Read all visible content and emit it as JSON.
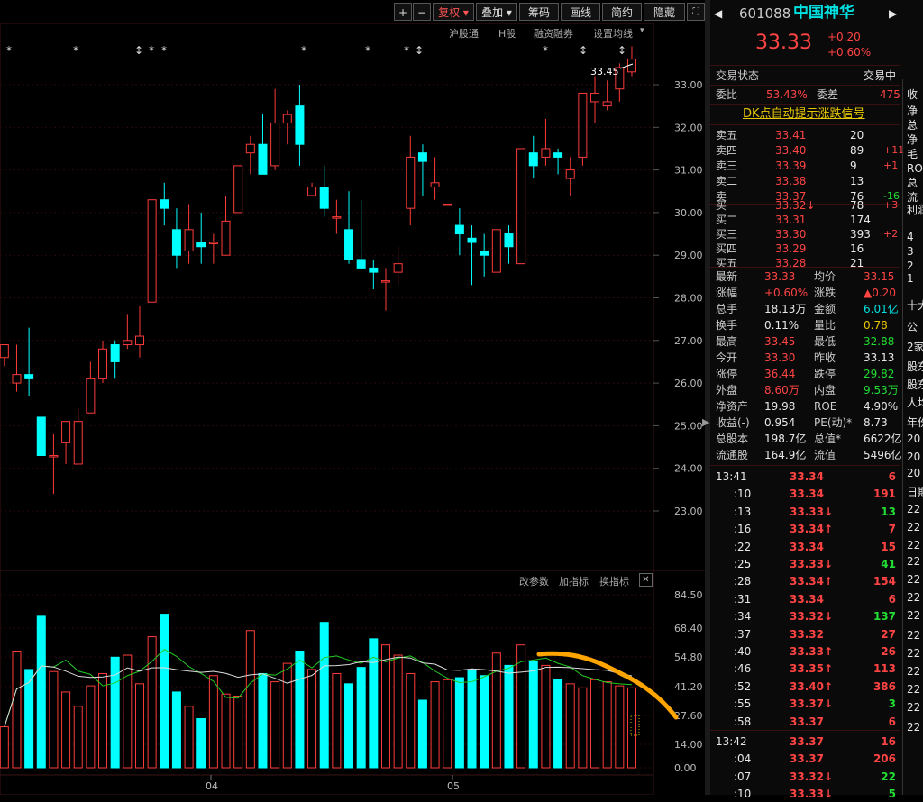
{
  "toolbar": {
    "plus": "+",
    "minus": "−",
    "fuquan": "复权",
    "diejia": "叠加",
    "chouma": "筹码",
    "huaxian": "画线",
    "jianyue": "简约",
    "yincang": "隐藏"
  },
  "subbar": [
    "沪股通",
    "H股",
    "融资融券",
    "设置均线"
  ],
  "volbar": [
    "改参数",
    "加指标",
    "换指标"
  ],
  "chart_data": {
    "type": "candlestick",
    "price_axis": [
      "33.00",
      "32.00",
      "31.00",
      "30.00",
      "29.00",
      "28.00",
      "27.00",
      "26.00",
      "25.00",
      "24.00",
      "23.00"
    ],
    "volume_axis": [
      "84.50",
      "68.40",
      "54.80",
      "41.20",
      "27.60",
      "14.00",
      "0.00"
    ],
    "x_labels": [
      "04",
      "05"
    ],
    "annotation": "33.45",
    "markers": [
      "*",
      "*",
      "↕",
      "*",
      "*",
      "*",
      "*",
      "*",
      "↕",
      "*",
      "↕",
      "↕"
    ],
    "candles": [
      [
        26.6,
        26.9,
        26.7,
        26.4
      ],
      [
        26.0,
        26.2,
        26.9,
        25.8
      ],
      [
        26.2,
        26.1,
        27.3,
        25.7
      ],
      [
        25.2,
        24.3,
        25.2,
        24.3
      ],
      [
        24.3,
        24.3,
        24.8,
        23.4
      ],
      [
        24.6,
        25.1,
        25.1,
        24.1
      ],
      [
        24.1,
        25.1,
        25.4,
        24.1
      ],
      [
        25.3,
        26.1,
        26.5,
        25.3
      ],
      [
        26.1,
        26.8,
        27.0,
        26.0
      ],
      [
        26.9,
        26.5,
        27.0,
        26.1
      ],
      [
        26.9,
        27.0,
        27.6,
        26.8
      ],
      [
        26.9,
        27.1,
        27.8,
        26.6
      ],
      [
        27.9,
        30.3,
        30.3,
        27.9
      ],
      [
        30.3,
        30.1,
        30.7,
        29.7
      ],
      [
        29.6,
        29.0,
        30.1,
        28.7
      ],
      [
        29.1,
        29.6,
        30.2,
        28.8
      ],
      [
        29.3,
        29.2,
        30.0,
        28.8
      ],
      [
        29.3,
        29.3,
        29.5,
        28.8
      ],
      [
        29.0,
        29.8,
        30.4,
        29.0
      ],
      [
        30.0,
        31.1,
        31.1,
        30.0
      ],
      [
        31.4,
        31.6,
        31.8,
        30.9
      ],
      [
        31.6,
        30.9,
        32.3,
        30.9
      ],
      [
        31.1,
        32.1,
        32.9,
        31.0
      ],
      [
        32.1,
        32.3,
        32.4,
        31.6
      ],
      [
        32.5,
        31.6,
        33.0,
        31.1
      ],
      [
        30.4,
        30.6,
        30.7,
        30.4
      ],
      [
        30.6,
        30.1,
        31.1,
        29.9
      ],
      [
        29.9,
        29.9,
        30.3,
        29.5
      ],
      [
        29.6,
        28.9,
        30.5,
        28.8
      ],
      [
        28.9,
        28.7,
        30.3,
        28.7
      ],
      [
        28.7,
        28.6,
        28.9,
        28.2
      ],
      [
        28.4,
        28.4,
        28.7,
        27.7
      ],
      [
        28.6,
        28.8,
        29.2,
        28.3
      ],
      [
        30.1,
        31.3,
        31.8,
        29.7
      ],
      [
        31.4,
        31.2,
        31.6,
        30.4
      ],
      [
        30.6,
        30.7,
        31.3,
        30.3
      ],
      [
        30.2,
        30.2,
        30.2,
        30.2
      ],
      [
        29.7,
        29.5,
        30.1,
        29.0
      ],
      [
        29.4,
        29.3,
        29.7,
        28.3
      ],
      [
        29.1,
        29.0,
        29.5,
        28.5
      ],
      [
        28.6,
        29.6,
        29.6,
        28.6
      ],
      [
        29.5,
        29.2,
        29.7,
        28.8
      ],
      [
        28.8,
        31.5,
        31.5,
        28.8
      ],
      [
        31.4,
        31.1,
        31.8,
        30.8
      ],
      [
        31.3,
        31.5,
        32.2,
        31.1
      ],
      [
        31.4,
        31.3,
        31.5,
        30.9
      ],
      [
        30.8,
        31.0,
        31.3,
        30.4
      ],
      [
        31.3,
        32.8,
        32.8,
        31.1
      ],
      [
        32.6,
        32.8,
        33.2,
        32.1
      ],
      [
        32.5,
        32.6,
        33.1,
        32.4
      ],
      [
        32.9,
        33.4,
        33.5,
        32.6
      ],
      [
        33.3,
        33.6,
        33.9,
        33.2
      ]
    ],
    "volumes": [
      20,
      57,
      48,
      74,
      47,
      37,
      30,
      40,
      46,
      54,
      55,
      41,
      64,
      75,
      37,
      30,
      24,
      45,
      36,
      35,
      67,
      46,
      42,
      51,
      57,
      48,
      71,
      46,
      41,
      49,
      63,
      60,
      55,
      46,
      33,
      42,
      43,
      44,
      48,
      45,
      56,
      50,
      60,
      52,
      50,
      43,
      41,
      39,
      43,
      42,
      40,
      39
    ]
  },
  "quote": {
    "code": "601088",
    "name": "中国神华",
    "price": "33.33",
    "change": "+0.20",
    "pct": "+0.60%"
  },
  "status": {
    "label": "交易状态",
    "value": "交易中"
  },
  "weibi": {
    "l1": "委比",
    "v1": "53.43%",
    "l2": "委差",
    "v2": "475"
  },
  "dk_label": "DK点自动提示涨跌信号",
  "asks": [
    [
      "卖五",
      "33.41",
      "20",
      ""
    ],
    [
      "卖四",
      "33.40",
      "89",
      "+11"
    ],
    [
      "卖三",
      "33.39",
      "9",
      "+1"
    ],
    [
      "卖二",
      "33.38",
      "13",
      ""
    ],
    [
      "卖一",
      "33.37",
      "76",
      "-16"
    ]
  ],
  "bids": [
    [
      "买一",
      "33.32↓",
      "78",
      "+3"
    ],
    [
      "买二",
      "33.31",
      "174",
      ""
    ],
    [
      "买三",
      "33.30",
      "393",
      "+2"
    ],
    [
      "买四",
      "33.29",
      "16",
      ""
    ],
    [
      "买五",
      "33.28",
      "21",
      ""
    ]
  ],
  "stats": [
    [
      "最新",
      "33.33",
      "均价",
      "33.15"
    ],
    [
      "涨幅",
      "+0.60%",
      "涨跌",
      "▲0.20"
    ],
    [
      "总手",
      "18.13万",
      "金额",
      "6.01亿"
    ],
    [
      "换手",
      "0.11%",
      "量比",
      "0.78"
    ],
    [
      "最高",
      "33.45",
      "最低",
      "32.88"
    ],
    [
      "今开",
      "33.30",
      "昨收",
      "33.13"
    ],
    [
      "涨停",
      "36.44",
      "跌停",
      "29.82"
    ],
    [
      "外盘",
      "8.60万",
      "内盘",
      "9.53万"
    ],
    [
      "净资产",
      "19.98",
      "ROE",
      "4.90%"
    ],
    [
      "收益(-)",
      "0.954",
      "PE(动)*",
      "8.73"
    ],
    [
      "总股本",
      "198.7亿",
      "总值*",
      "6622亿"
    ],
    [
      "流通股",
      "164.9亿",
      "流值",
      "5496亿"
    ]
  ],
  "ticks": [
    [
      "13:41",
      "33.34",
      "6",
      ""
    ],
    [
      ":10",
      "33.34",
      "191",
      ""
    ],
    [
      ":13",
      "33.33↓",
      "13",
      ""
    ],
    [
      ":16",
      "33.34↑",
      "7",
      ""
    ],
    [
      ":22",
      "33.34",
      "15",
      ""
    ],
    [
      ":25",
      "33.33↓",
      "41",
      ""
    ],
    [
      ":28",
      "33.34↑",
      "154",
      ""
    ],
    [
      ":31",
      "33.34",
      "6",
      ""
    ],
    [
      ":34",
      "33.32↓",
      "137",
      ""
    ],
    [
      ":37",
      "33.32",
      "27",
      ""
    ],
    [
      ":40",
      "33.33↑",
      "26",
      ""
    ],
    [
      ":46",
      "33.35↑",
      "113",
      ""
    ],
    [
      ":52",
      "33.40↑",
      "386",
      ""
    ],
    [
      ":55",
      "33.37↓",
      "3",
      ""
    ],
    [
      ":58",
      "33.37",
      "6",
      ""
    ],
    [
      "13:42",
      "33.37",
      "16",
      ""
    ],
    [
      ":04",
      "33.37",
      "206",
      ""
    ],
    [
      ":07",
      "33.32↓",
      "22",
      ""
    ],
    [
      ":10",
      "33.33↓",
      "5",
      ""
    ]
  ],
  "side_clip": [
    "收",
    "净",
    "总",
    "净",
    "毛",
    "RO",
    "总",
    "流",
    "利润",
    "4",
    "3",
    "2",
    "1",
    "十大",
    "公",
    "2家",
    "股东",
    "股东",
    "人均",
    "年份",
    "20",
    "20",
    "20",
    "日期",
    "22",
    "22",
    "22",
    "22",
    "22",
    "22",
    "22",
    "22",
    "22",
    "22",
    "22",
    "22",
    "22"
  ]
}
